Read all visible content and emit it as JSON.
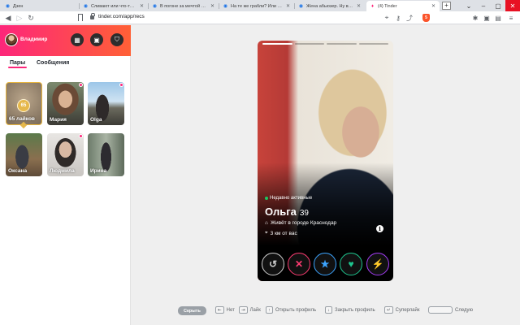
{
  "browser": {
    "tabs": [
      {
        "title": "Дзен",
        "favicon": "dzen-icon"
      },
      {
        "title": "Сливают или что-то не так? - Дзен",
        "favicon": "dzen-icon"
      },
      {
        "title": "В погоне за мечтой или прив",
        "favicon": "dzen-icon"
      },
      {
        "title": "На те же грабли? Или улучши",
        "favicon": "dzen-icon"
      },
      {
        "title": "Жена абьюзер. Ну все нафиг",
        "favicon": "dzen-icon"
      },
      {
        "title": "(4) Tinder",
        "favicon": "tinder-icon"
      }
    ],
    "new_tab": "+",
    "url": "tinder.com/app/recs",
    "extension_badge": "5"
  },
  "sidebar": {
    "user_name": "Владимир",
    "tabs": [
      "Пары",
      "Сообщения"
    ],
    "cards": [
      {
        "label": "65 лайков",
        "badge": "65",
        "kind": "likes",
        "unread": false
      },
      {
        "label": "Мария",
        "kind": "match",
        "unread": true
      },
      {
        "label": "Olga",
        "kind": "match",
        "unread": true
      },
      {
        "label": "Оксана",
        "kind": "match",
        "unread": false
      },
      {
        "label": "Людмила",
        "kind": "match",
        "unread": true
      },
      {
        "label": "Ирина",
        "kind": "match",
        "unread": false
      }
    ]
  },
  "profile": {
    "status": "Недавно активные",
    "name": "Ольга",
    "age": "39",
    "city": "Живёт в городе Краснодар",
    "distance": "3 км от вас",
    "info_glyph": "i",
    "photos_total": 4,
    "photo_current": 1
  },
  "actions": [
    {
      "name": "rewind-button",
      "icon": "rewind-icon",
      "glyph": "↺",
      "color": "#cfcfcf"
    },
    {
      "name": "nope-button",
      "icon": "close-icon",
      "glyph": "✕",
      "color": "#fe3c72"
    },
    {
      "name": "super-like-button",
      "icon": "star-icon",
      "glyph": "★",
      "color": "#3ca4ff"
    },
    {
      "name": "like-button",
      "icon": "heart-icon",
      "glyph": "♥",
      "color": "#1ec68f"
    },
    {
      "name": "boost-button",
      "icon": "lightning-icon",
      "glyph": "⚡",
      "color": "#a43cf7"
    }
  ],
  "hints": {
    "hide": "Скрыть",
    "no": "Нет",
    "like": "Лайк",
    "open_profile": "Открыть профиль",
    "close_profile": "Закрыть профиль",
    "superlike": "Суперлайк",
    "next": "Следую"
  },
  "colors": {
    "brand_start": "#fd267a",
    "brand_end": "#ff6036",
    "likes_gold": "#e6b84b"
  }
}
